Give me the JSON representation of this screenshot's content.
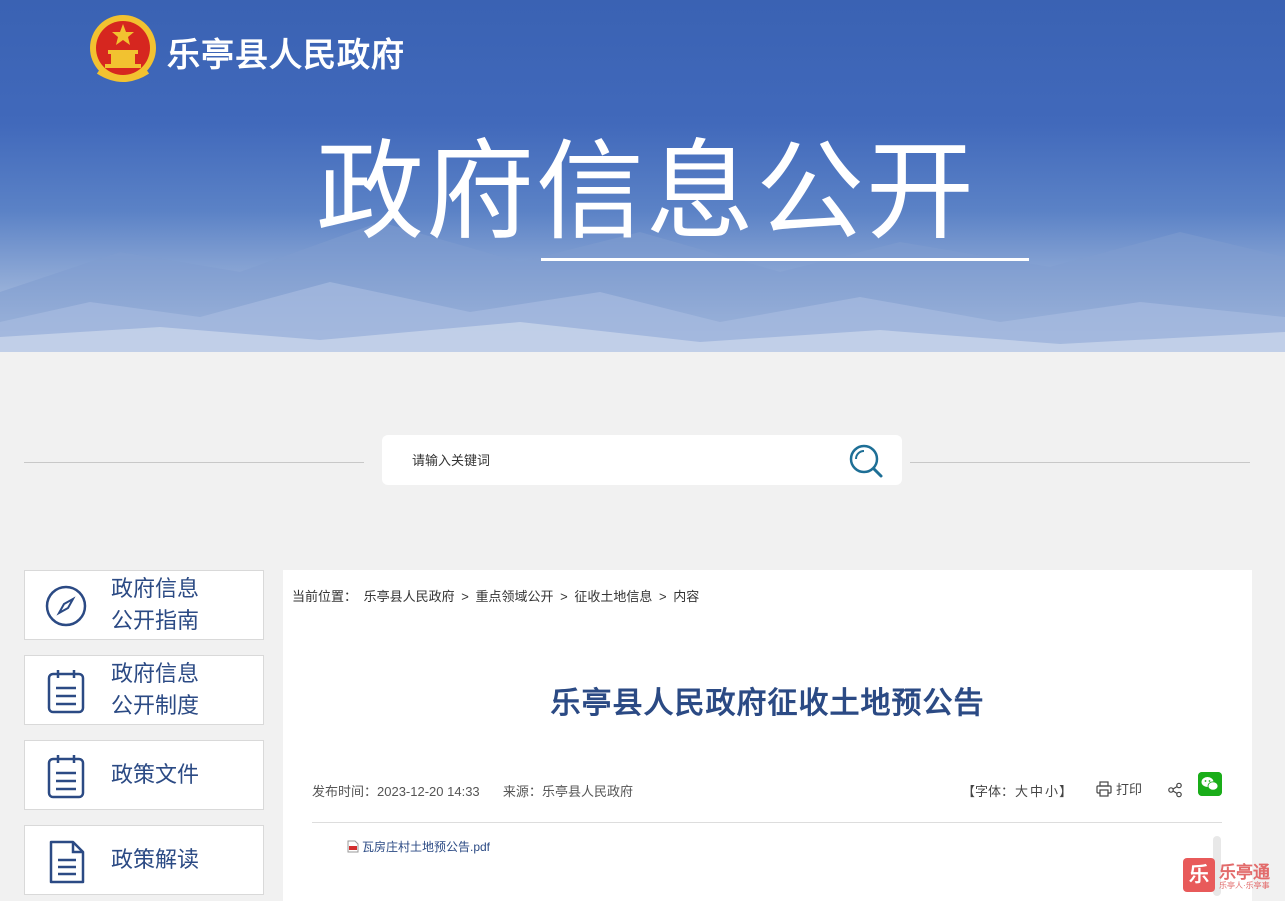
{
  "header": {
    "site_name": "乐亭县人民政府",
    "hero_title": "政府信息公开"
  },
  "search": {
    "placeholder": "请输入关键词"
  },
  "sidebar": {
    "items": [
      {
        "line1": "政府信息",
        "line2": "公开指南",
        "icon": "compass-icon"
      },
      {
        "line1": "政府信息",
        "line2": "公开制度",
        "icon": "clipboard-icon"
      },
      {
        "label": "政策文件",
        "icon": "clipboard-icon"
      },
      {
        "label": "政策解读",
        "icon": "document-icon"
      }
    ]
  },
  "breadcrumb": {
    "prefix": "当前位置：",
    "items": [
      "乐亭县人民政府",
      "重点领域公开",
      "征收土地信息",
      "内容"
    ],
    "separator": ">"
  },
  "article": {
    "title": "乐亭县人民政府征收土地预公告",
    "publish_label": "发布时间：",
    "publish_time": "2023-12-20 14:33",
    "source_label": "来源：",
    "source": "乐亭县人民政府",
    "fontsize_open": "【字体：",
    "fontsize_large": "大",
    "fontsize_medium": "中",
    "fontsize_small": "小",
    "fontsize_close": "】",
    "print_label": "打印",
    "attachment": "瓦房庄村土地预公告.pdf"
  },
  "corner_badge": {
    "glyph": "乐",
    "name": "乐亭通",
    "sub": "乐亭人·乐亭事"
  },
  "colors": {
    "banner_blue": "#4169bb",
    "title_blue": "#2b4a84",
    "background": "#f1f1f1"
  }
}
